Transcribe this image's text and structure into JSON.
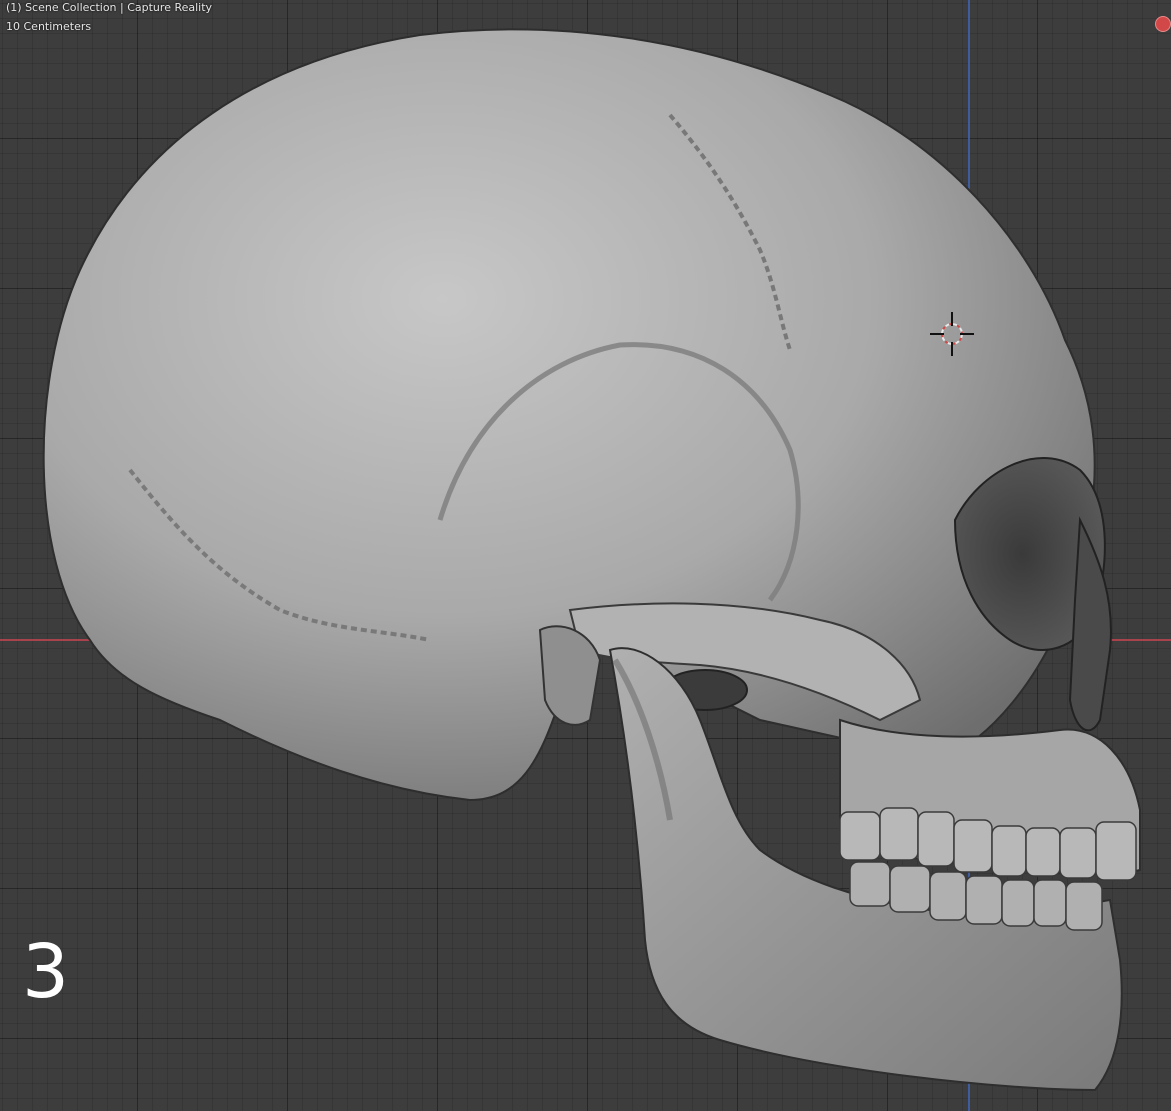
{
  "viewport": {
    "header_title": "(1) Scene Collection | Capture Reality",
    "scale_label": "10 Centimeters",
    "step_number": "3"
  },
  "colors": {
    "background": "#3d3d3d",
    "x_axis": "#b4444f",
    "y_axis": "#3f61a8",
    "skull": "#a4a4a4",
    "record_dot": "#d24747"
  },
  "icons": {
    "record": "record-dot-icon",
    "cursor": "3d-cursor-icon"
  }
}
